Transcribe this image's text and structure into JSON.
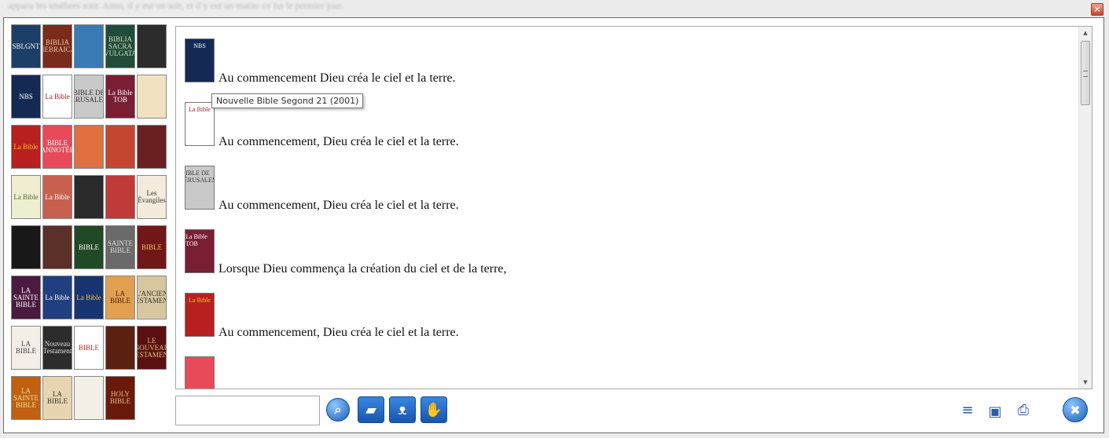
{
  "background_text": "apparu les ténèbres sont. Ainsi, il y eut un soir, et il y eut un matin: ce fut le premier jour.",
  "window": {
    "close_symbol": "×"
  },
  "covers": [
    {
      "label": "SBLGNT",
      "bg": "#1d3e66",
      "fg": "#ffffff"
    },
    {
      "label": "BIBLIA HEBRAICA",
      "bg": "#7a2b1c",
      "fg": "#e8c9a0"
    },
    {
      "label": "",
      "bg": "#3a7ab5",
      "fg": "#ffffff"
    },
    {
      "label": "BIBLIA SACRA VULGATA",
      "bg": "#1f4d3a",
      "fg": "#d8d8c0"
    },
    {
      "label": "",
      "bg": "#2c2c2c",
      "fg": "#aaaaaa"
    },
    {
      "label": "NBS",
      "bg": "#142a55",
      "fg": "#ffffff"
    },
    {
      "label": "La Bible",
      "bg": "#ffffff",
      "fg": "#a02020"
    },
    {
      "label": "BIBLE DE JÉRUSALEM",
      "bg": "#c9c9c9",
      "fg": "#333333"
    },
    {
      "label": "La Bible TOB",
      "bg": "#7a1e34",
      "fg": "#ffffff"
    },
    {
      "label": "",
      "bg": "#f0e2c0",
      "fg": "#8a6a3a"
    },
    {
      "label": "La Bible",
      "bg": "#b81f1f",
      "fg": "#f5c030"
    },
    {
      "label": "BIBLE ANNOTÉE",
      "bg": "#e84a5a",
      "fg": "#ffffff"
    },
    {
      "label": "",
      "bg": "#e07040",
      "fg": "#ffffff"
    },
    {
      "label": "",
      "bg": "#c44530",
      "fg": "#ffffff"
    },
    {
      "label": "",
      "bg": "#6a2020",
      "fg": "#ffffff"
    },
    {
      "label": "La Bible",
      "bg": "#eeeed0",
      "fg": "#556622"
    },
    {
      "label": "La Bible",
      "bg": "#c86050",
      "fg": "#ffffff"
    },
    {
      "label": "",
      "bg": "#2a2a2a",
      "fg": "#c03050"
    },
    {
      "label": "",
      "bg": "#c03a3a",
      "fg": "#ffffff"
    },
    {
      "label": "Les Évangiles",
      "bg": "#f3ecdc",
      "fg": "#333333"
    },
    {
      "label": "",
      "bg": "#181818",
      "fg": "#777777"
    },
    {
      "label": "",
      "bg": "#5a3028",
      "fg": "#ffffff"
    },
    {
      "label": "BIBLE",
      "bg": "#204a25",
      "fg": "#ffffff"
    },
    {
      "label": "SAINTE BIBLE",
      "bg": "#6a6a6a",
      "fg": "#dddddd"
    },
    {
      "label": "BIBLE",
      "bg": "#701818",
      "fg": "#f0c060"
    },
    {
      "label": "LA SAINTE BIBLE",
      "bg": "#4a1a40",
      "fg": "#ffffff"
    },
    {
      "label": "La Bible",
      "bg": "#1f3f80",
      "fg": "#ffffff"
    },
    {
      "label": "La Bible",
      "bg": "#183470",
      "fg": "#f2c050"
    },
    {
      "label": "LA BIBLE",
      "bg": "#e0a050",
      "fg": "#4a2010"
    },
    {
      "label": "L'ANCIEN TESTAMENT",
      "bg": "#d7c7a0",
      "fg": "#333333"
    },
    {
      "label": "LA BIBLE",
      "bg": "#f3efe7",
      "fg": "#444444"
    },
    {
      "label": "Nouveau Testament",
      "bg": "#2c2c2c",
      "fg": "#dddddd"
    },
    {
      "label": "BIBLE",
      "bg": "#ffffff",
      "fg": "#cc2020"
    },
    {
      "label": "",
      "bg": "#5a2010",
      "fg": "#ffffff"
    },
    {
      "label": "LE NOUVEAU TESTAMENT",
      "bg": "#5a1010",
      "fg": "#e0c080"
    },
    {
      "label": "LA SAINTE BIBLE",
      "bg": "#c06010",
      "fg": "#f6e0a0"
    },
    {
      "label": "LA BIBLE",
      "bg": "#e6d5b0",
      "fg": "#333333"
    },
    {
      "label": "",
      "bg": "#f4f0e8",
      "fg": "#333333"
    },
    {
      "label": "HOLY BIBLE",
      "bg": "#6a1a0a",
      "fg": "#e0c080"
    }
  ],
  "entries": [
    {
      "thumb": "NBS",
      "thumb_bg": "#142a55",
      "thumb_fg": "#ffffff",
      "text": "Au commencement Dieu créa le ciel et la terre."
    },
    {
      "thumb": "La Bible",
      "thumb_bg": "#ffffff",
      "thumb_fg": "#a02020",
      "text": "Au commencement, Dieu créa le ciel et la terre."
    },
    {
      "thumb": "BIBLE DE JÉRUSALEM",
      "thumb_bg": "#c9c9c9",
      "thumb_fg": "#333333",
      "text": "Au commencement, Dieu créa le ciel et la terre."
    },
    {
      "thumb": "La Bible TOB",
      "thumb_bg": "#7a1e34",
      "thumb_fg": "#ffffff",
      "text": "Lorsque Dieu commença la création du ciel et de la terre,"
    },
    {
      "thumb": "La Bible",
      "thumb_bg": "#b81f1f",
      "thumb_fg": "#f5c030",
      "text": "Au commencement, Dieu créa le ciel et la terre."
    },
    {
      "thumb": "",
      "thumb_bg": "#e84a5a",
      "thumb_fg": "#ffffff",
      "text": ""
    }
  ],
  "tooltip": "Nouvelle Bible Segond 21 (2001)",
  "search": {
    "value": ""
  },
  "buttons": {
    "search_glyph": "⌕",
    "book_glyph": "▰",
    "fish_glyph": "ᴥ",
    "pray_glyph": "✋",
    "compare_glyph": "≡",
    "save_glyph": "▣",
    "print_glyph": "⎙",
    "close_glyph": "✖"
  },
  "scroll": {
    "up": "▲",
    "down": "▼",
    "grip": "≡"
  }
}
